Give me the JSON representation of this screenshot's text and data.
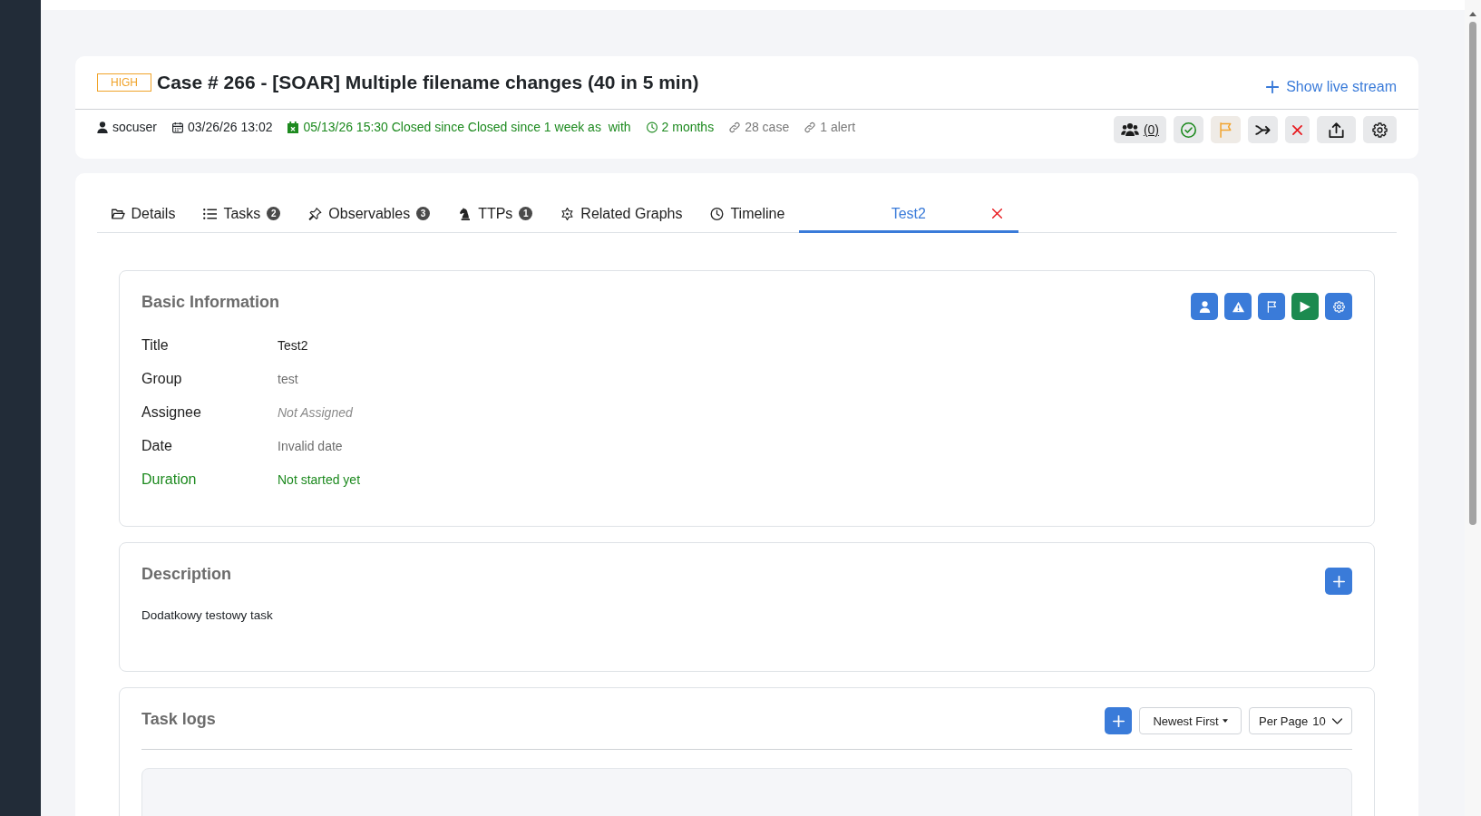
{
  "case": {
    "severity": "HIGH",
    "title": "Case # 266 - [SOAR] Multiple filename changes (40 in 5 min)",
    "live_stream": "Show live stream",
    "meta": [
      {
        "kind": "user",
        "text": "socuser"
      },
      {
        "kind": "opened",
        "text": "03/26/26 13:02"
      },
      {
        "kind": "closed",
        "text": "05/13/26 15:30 Closed since Closed since 1 week as  with"
      },
      {
        "kind": "age",
        "text": "2 months"
      },
      {
        "kind": "cases",
        "text": "28 case"
      },
      {
        "kind": "alerts",
        "text": "1 alert"
      }
    ],
    "actions": [
      {
        "kind": "assignees",
        "label": "(0)"
      },
      {
        "kind": "resolve"
      },
      {
        "kind": "flag"
      },
      {
        "kind": "merge"
      },
      {
        "kind": "close"
      },
      {
        "kind": "export"
      },
      {
        "kind": "settings"
      }
    ]
  },
  "tabs": [
    {
      "kind": "details",
      "label": "Details",
      "selected": false
    },
    {
      "kind": "tasks",
      "label": "Tasks",
      "count": "2",
      "selected": false
    },
    {
      "kind": "observables",
      "label": "Observables",
      "count": "3",
      "selected": false
    },
    {
      "kind": "ttps",
      "label": "TTPs",
      "count": "1",
      "selected": false
    },
    {
      "kind": "graphs",
      "label": "Related Graphs",
      "selected": false
    },
    {
      "kind": "timeline",
      "label": "Timeline",
      "selected": false
    },
    {
      "kind": "task",
      "label": "Test2",
      "selected": true
    }
  ],
  "basic_information": {
    "title": "Basic Information",
    "actions": [
      {
        "kind": "assign"
      },
      {
        "kind": "alert"
      },
      {
        "kind": "flag"
      },
      {
        "kind": "start"
      },
      {
        "kind": "settings"
      }
    ],
    "fields": [
      {
        "kind": "strong",
        "label": "Title",
        "value": "Test2"
      },
      {
        "kind": "plain",
        "label": "Group",
        "value": "test"
      },
      {
        "kind": "empty",
        "label": "Assignee",
        "value": "Not Assigned"
      },
      {
        "kind": "plain",
        "label": "Date",
        "value": "Invalid date"
      },
      {
        "kind": "status",
        "label": "Duration",
        "value": "Not started yet"
      }
    ]
  },
  "description": {
    "title": "Description",
    "text": "Dodatkowy testowy task"
  },
  "task_logs": {
    "title": "Task logs",
    "sort": "Newest First",
    "per_page": {
      "label": "Per Page",
      "value": "10"
    }
  }
}
